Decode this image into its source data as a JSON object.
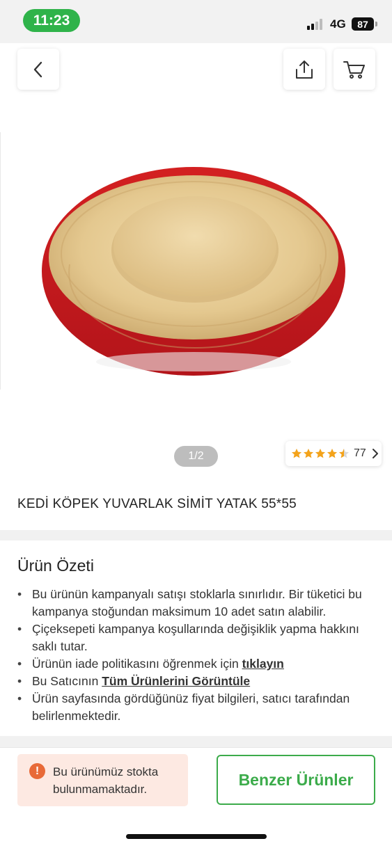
{
  "status_bar": {
    "time": "11:23",
    "network": "4G",
    "battery": "87"
  },
  "gallery": {
    "pager": "1/2"
  },
  "rating": {
    "count": "77",
    "stars": 4.5
  },
  "product": {
    "title": "KEDİ KÖPEK YUVARLAK SİMİT YATAK 55*55"
  },
  "summary": {
    "title": "Ürün Özeti",
    "items": [
      {
        "text": "Bu ürünün kampanyalı satışı stoklarla sınırlıdır. Bir tüketici bu kampanya stoğundan maksimum 10 adet satın alabilir."
      },
      {
        "text": "Çiçeksepeti kampanya koşullarında değişiklik yapma hakkını saklı tutar."
      },
      {
        "text": "Ürünün iade politikasını öğrenmek için ",
        "link": "tıklayın"
      },
      {
        "text": "Bu Satıcının ",
        "link": "Tüm Ürünlerini Görüntüle"
      },
      {
        "text": "Ürün sayfasında gördüğünüz fiyat bilgileri, satıcı tarafından belirlenmektedir."
      }
    ]
  },
  "bottom": {
    "alert_icon": "!",
    "stock_alert": "Bu ürünümüz stokta bulunmamaktadır.",
    "similar_button": "Benzer Ürünler"
  },
  "colors": {
    "brand_green": "#3bab4a",
    "status_green": "#2fb34a",
    "star": "#f4a31a",
    "alert_bg": "#fde9e2",
    "alert_icon": "#e86a38"
  },
  "icons": [
    "back-arrow-icon",
    "share-icon",
    "cart-icon",
    "star-icon",
    "chevron-right-icon",
    "alert-icon"
  ]
}
